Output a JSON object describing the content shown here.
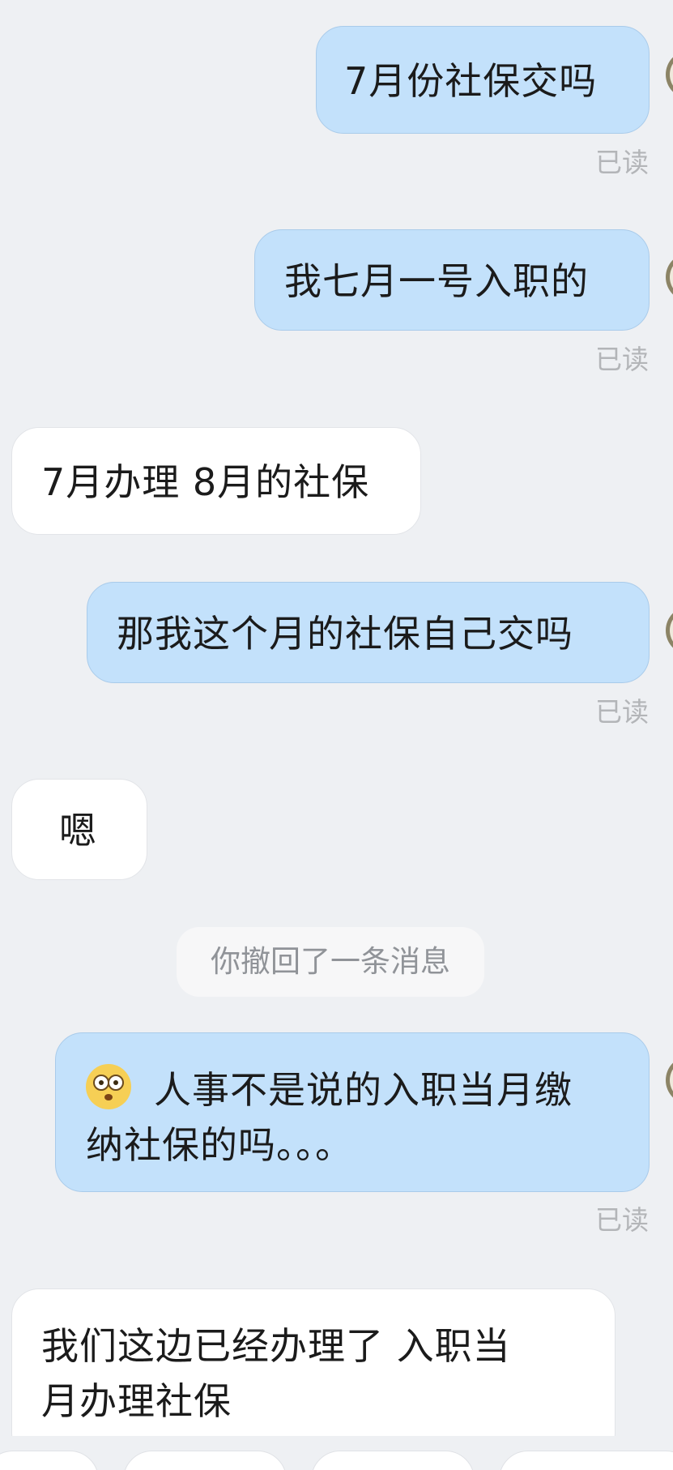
{
  "messages": [
    {
      "direction": "out",
      "text": "7月份社保交吗",
      "status": "已读"
    },
    {
      "direction": "out",
      "text": "我七月一号入职的",
      "status": "已读"
    },
    {
      "direction": "in",
      "text": "7月办理 8月的社保"
    },
    {
      "direction": "out",
      "text": "那我这个月的社保自己交吗",
      "status": "已读"
    },
    {
      "direction": "in",
      "text": "嗯"
    },
    {
      "direction": "system",
      "text": "你撤回了一条消息"
    },
    {
      "direction": "out",
      "emoji": "flushed-face",
      "text_line1": "人事不是说的入职当月缴",
      "text_line2": "纳社保的吗。。。",
      "status": "已读"
    },
    {
      "direction": "in",
      "text_line1": "我们这边已经办理了 入职当",
      "text_line2": "月办理社保"
    }
  ],
  "colors": {
    "background": "#eef0f3",
    "outgoing_bubble": "#c3e1fb",
    "incoming_bubble": "#ffffff",
    "read_status": "#b3b5b8",
    "system_text": "#909398"
  }
}
